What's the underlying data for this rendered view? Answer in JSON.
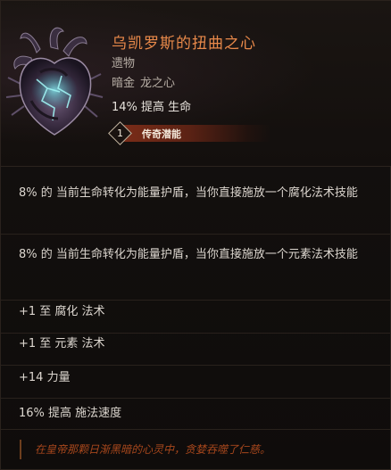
{
  "item": {
    "name": "乌凯罗斯的扭曲之心",
    "type": "遗物",
    "subtype_rarity": "暗金",
    "subtype_kind": "龙之心",
    "base_stat": "14% 提高 生命",
    "potential": {
      "value": "1",
      "label": "传奇潜能"
    }
  },
  "affixes": [
    "8% 的 当前生命转化为能量护盾，当你直接施放一个腐化法术技能",
    "8% 的 当前生命转化为能量护盾，当你直接施放一个元素法术技能",
    "+1 至 腐化 法术",
    "+1 至 元素 法术",
    "+14 力量",
    "16% 提高 施法速度"
  ],
  "flavor": "在皇帝那颗日渐黑暗的心灵中，贪婪吞噬了仁慈。",
  "colors": {
    "name": "#e8894a",
    "flavor": "#a7471c",
    "text": "#dcd6cf",
    "potential_bar": "#7a2c18"
  },
  "icons": {
    "item": "twisted-heart-icon",
    "potential": "diamond-badge-icon"
  }
}
